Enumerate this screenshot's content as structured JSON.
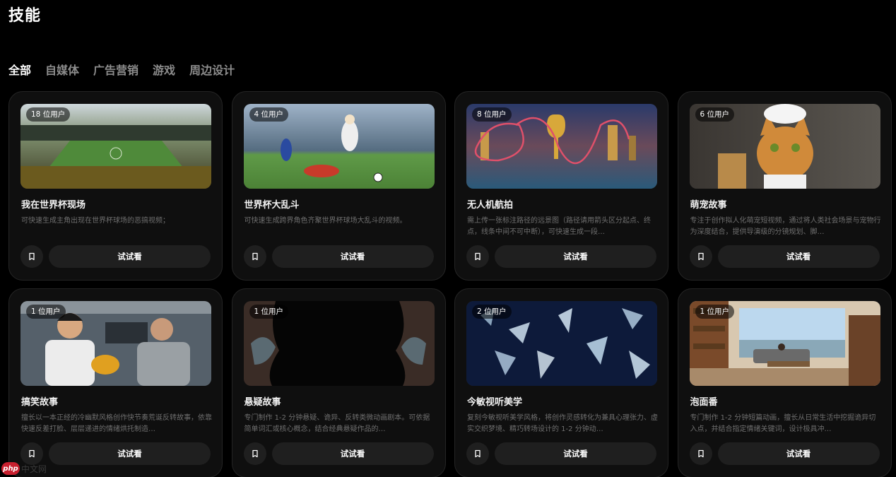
{
  "page": {
    "title": "技能"
  },
  "tabs": [
    {
      "label": "全部",
      "active": true
    },
    {
      "label": "自媒体",
      "active": false
    },
    {
      "label": "广告营销",
      "active": false
    },
    {
      "label": "游戏",
      "active": false
    },
    {
      "label": "周边设计",
      "active": false
    }
  ],
  "cards": [
    {
      "badge": "18 位用户",
      "title": "我在世界杯现场",
      "desc": "可快速生成主角出现在世界杯球场的恶搞视频；",
      "button": "试试看"
    },
    {
      "badge": "4 位用户",
      "title": "世界杯大乱斗",
      "desc": "可快速生成跨界角色齐聚世界杯球场大乱斗的视频。",
      "button": "试试看"
    },
    {
      "badge": "8 位用户",
      "title": "无人机航拍",
      "desc": "需上传一张标注路径的远景图（路径请用箭头区分起点、终点，线条中间不可中断），可快速生成一段…",
      "button": "试试看"
    },
    {
      "badge": "6 位用户",
      "title": "萌宠故事",
      "desc": "专注于创作拟人化萌宠短视频，通过将人类社会场景与宠物行为深度结合，提供导演级的分镜规划、脚…",
      "button": "试试看"
    },
    {
      "badge": "1 位用户",
      "title": "搞笑故事",
      "desc": "擅长以一本正经的冷幽默风格创作快节奏荒诞反转故事，依靠快速反差打脸、层层递进的情绪烘托制造…",
      "button": "试试看"
    },
    {
      "badge": "1 位用户",
      "title": "悬疑故事",
      "desc": "专门制作 1-2 分钟悬疑、诡异、反转类微动画剧本。可依据简单词汇或核心概念，结合经典悬疑作品的…",
      "button": "试试看"
    },
    {
      "badge": "2 位用户",
      "title": "今敏视听美学",
      "desc": "复刻今敏视听美学风格，将创作灵感转化为兼具心理张力、虚实交织梦境、精巧转场设计的 1-2 分钟动…",
      "button": "试试看"
    },
    {
      "badge": "1 位用户",
      "title": "泡面番",
      "desc": "专门制作 1-2 分钟短篇动画，擅长从日常生活中挖掘诡异切入点，并结合指定情绪关键词，设计极具冲…",
      "button": "试试看"
    }
  ],
  "icons": {
    "bookmark": "bookmark-icon"
  },
  "watermark": {
    "logo": "php",
    "text": "中文网"
  },
  "colors": {
    "background": "#000000",
    "card": "#0f0f0f",
    "button": "#1f1f1f",
    "muted_text": "#6f6f6f"
  }
}
